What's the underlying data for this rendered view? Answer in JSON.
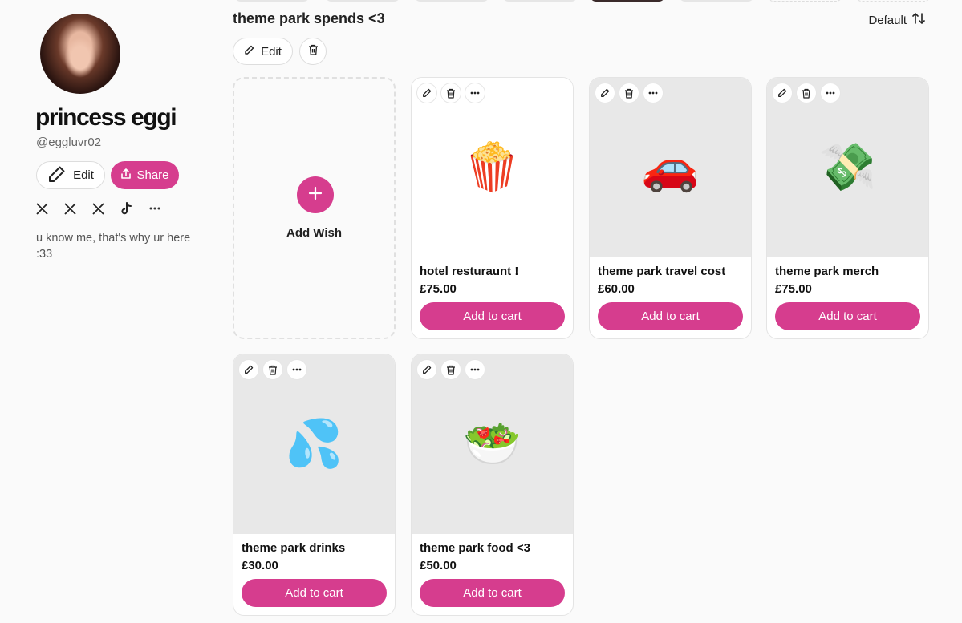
{
  "profile": {
    "name": "princess eggi",
    "handle": "@eggluvr02",
    "edit_label": "Edit",
    "share_label": "Share",
    "bio": "u know me, that's why ur here :33",
    "socials": [
      "x-icon",
      "x-icon",
      "x-icon",
      "tiktok-icon",
      "more-icon"
    ]
  },
  "list": {
    "title": "theme park spends <3",
    "edit_label": "Edit",
    "sort_label": "Default",
    "add_wish_label": "Add Wish"
  },
  "items": [
    {
      "name": "hotel resturaunt !",
      "price": "£75.00",
      "button": "Add to cart",
      "emoji": "🍿",
      "image_bg": "#ffffff"
    },
    {
      "name": "theme park travel cost",
      "price": "£60.00",
      "button": "Add to cart",
      "emoji": "🚗",
      "image_bg": "#e8e8e8"
    },
    {
      "name": "theme park merch",
      "price": "£75.00",
      "button": "Add to cart",
      "emoji": "💸",
      "image_bg": "#e8e8e8"
    },
    {
      "name": "theme park drinks",
      "price": "£30.00",
      "button": "Add to cart",
      "emoji": "💦",
      "image_bg": "#e8e8e8"
    },
    {
      "name": "theme park food <3",
      "price": "£50.00",
      "button": "Add to cart",
      "emoji": "🥗",
      "image_bg": "#e8e8e8"
    }
  ],
  "colors": {
    "accent": "#d63d8e",
    "background": "#fafafa"
  }
}
